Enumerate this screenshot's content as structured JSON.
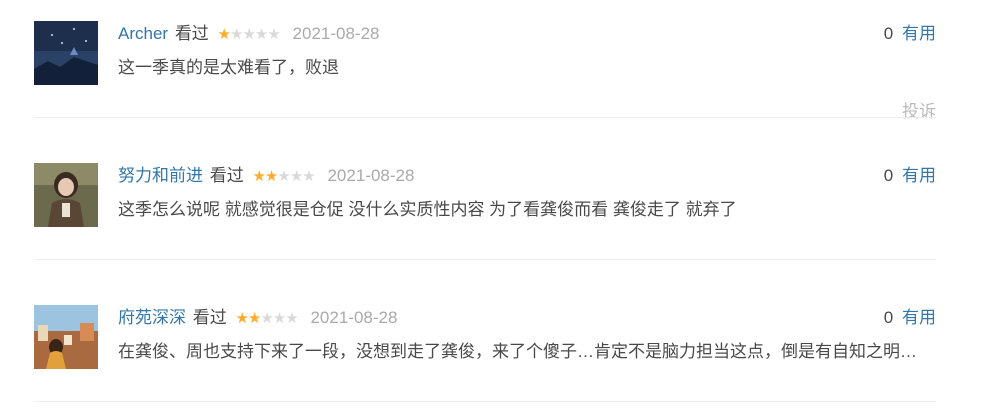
{
  "reviews": [
    {
      "username": "Archer",
      "watched": "看过",
      "rating": 1,
      "date": "2021-08-28",
      "votes": "0",
      "useful": "有用",
      "content": "这一季真的是太难看了，败退",
      "report": "投诉"
    },
    {
      "username": "努力和前进",
      "watched": "看过",
      "rating": 2,
      "date": "2021-08-28",
      "votes": "0",
      "useful": "有用",
      "content": "这季怎么说呢 就感觉很是仓促 没什么实质性内容 为了看龚俊而看 龚俊走了 就弃了"
    },
    {
      "username": "府苑深深",
      "watched": "看过",
      "rating": 2,
      "date": "2021-08-28",
      "votes": "0",
      "useful": "有用",
      "content": "在龚俊、周也支持下来了一段，没想到走了龚俊，来了个傻子…肯定不是脑力担当这点，倒是有自知之明…"
    }
  ],
  "colors": {
    "link": "#3377aa",
    "star_on": "#ffac2d",
    "star_off": "#d9d9d9",
    "date": "#aaaaaa"
  },
  "icons": {
    "star": "star-icon"
  }
}
